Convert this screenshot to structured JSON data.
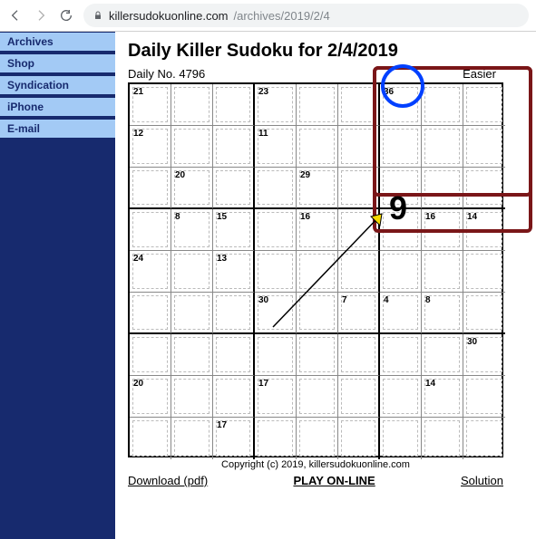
{
  "browser": {
    "domain": "killersudokuonline.com",
    "path": "/archives/2019/2/4"
  },
  "sidebar": {
    "items": [
      {
        "label": "Archives"
      },
      {
        "label": "Shop"
      },
      {
        "label": "Syndication"
      },
      {
        "label": "iPhone"
      },
      {
        "label": "E-mail"
      }
    ]
  },
  "page": {
    "title": "Daily Killer Sudoku for 2/4/2019",
    "daily_no": "Daily No. 4796",
    "difficulty": "Easier",
    "copyright": "Copyright (c) 2019, killersudokuonline.com",
    "download": "Download (pdf)",
    "play": "PLAY ON-LINE",
    "solution": "Solution"
  },
  "cages": [
    {
      "r": 0,
      "c": 0,
      "v": "21"
    },
    {
      "r": 0,
      "c": 3,
      "v": "23"
    },
    {
      "r": 0,
      "c": 6,
      "v": "36"
    },
    {
      "r": 1,
      "c": 0,
      "v": "12"
    },
    {
      "r": 1,
      "c": 3,
      "v": "11"
    },
    {
      "r": 2,
      "c": 1,
      "v": "20"
    },
    {
      "r": 2,
      "c": 4,
      "v": "29"
    },
    {
      "r": 3,
      "c": 1,
      "v": "8"
    },
    {
      "r": 3,
      "c": 2,
      "v": "15"
    },
    {
      "r": 3,
      "c": 4,
      "v": "16"
    },
    {
      "r": 3,
      "c": 7,
      "v": "16"
    },
    {
      "r": 3,
      "c": 8,
      "v": "14"
    },
    {
      "r": 4,
      "c": 0,
      "v": "24"
    },
    {
      "r": 4,
      "c": 2,
      "v": "13"
    },
    {
      "r": 5,
      "c": 3,
      "v": "30"
    },
    {
      "r": 5,
      "c": 5,
      "v": "7"
    },
    {
      "r": 5,
      "c": 6,
      "v": "4"
    },
    {
      "r": 5,
      "c": 7,
      "v": "8"
    },
    {
      "r": 6,
      "c": 8,
      "v": "30"
    },
    {
      "r": 7,
      "c": 0,
      "v": "20"
    },
    {
      "r": 7,
      "c": 3,
      "v": "17"
    },
    {
      "r": 7,
      "c": 7,
      "v": "14"
    },
    {
      "r": 8,
      "c": 2,
      "v": "17"
    }
  ],
  "annotation": {
    "digit": "9"
  }
}
